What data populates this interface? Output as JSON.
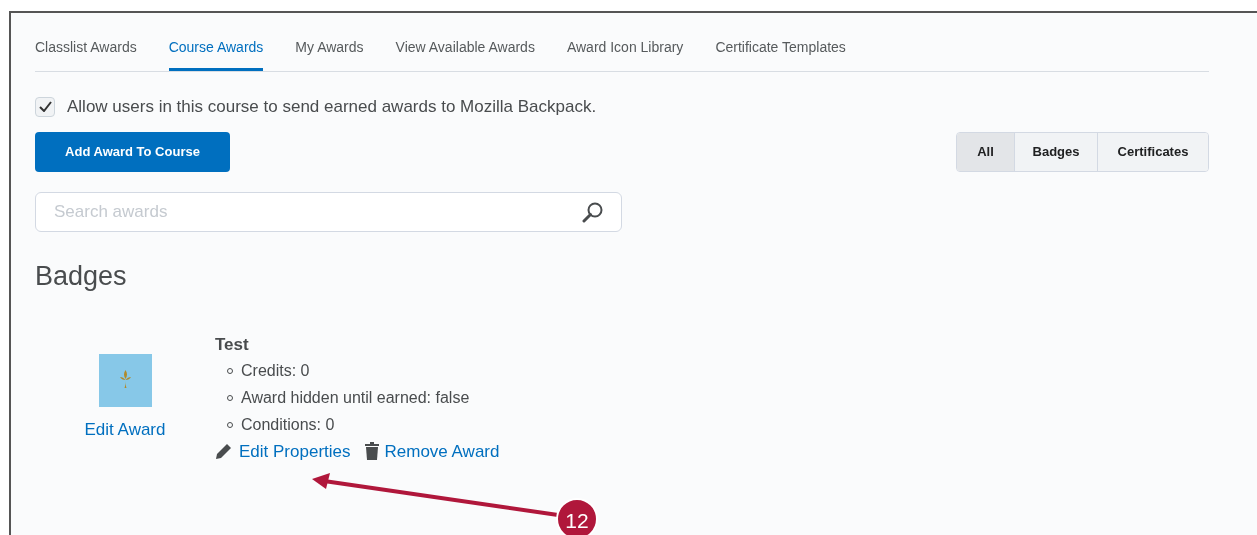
{
  "tabs": [
    {
      "label": "Classlist Awards",
      "selected": false
    },
    {
      "label": "Course Awards",
      "selected": true
    },
    {
      "label": "My Awards",
      "selected": false
    },
    {
      "label": "View Available Awards",
      "selected": false
    },
    {
      "label": "Award Icon Library",
      "selected": false
    },
    {
      "label": "Certificate Templates",
      "selected": false
    }
  ],
  "backpack_option": {
    "label": "Allow users in this course to send earned awards to Mozilla Backpack.",
    "checked": true
  },
  "add_button": "Add Award To Course",
  "filters": [
    {
      "label": "All",
      "selected": true
    },
    {
      "label": "Badges",
      "selected": false
    },
    {
      "label": "Certificates",
      "selected": false
    }
  ],
  "search": {
    "placeholder": "Search awards"
  },
  "section_title": "Badges",
  "award": {
    "edit_award": "Edit Award",
    "name": "Test",
    "details": [
      "Credits: 0",
      "Award hidden until earned: false",
      "Conditions: 0"
    ],
    "edit_properties": "Edit Properties",
    "remove": "Remove Award"
  },
  "callout": "12"
}
